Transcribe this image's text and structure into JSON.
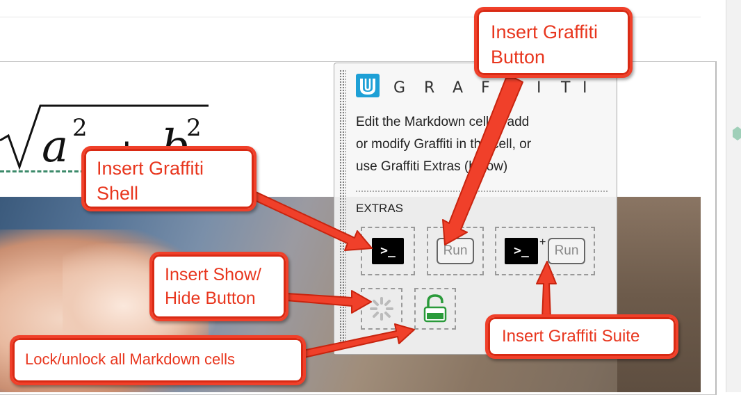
{
  "formula": {
    "latex_visible": "√(a² + b²)",
    "a": "a",
    "b": "b",
    "exp": "2",
    "plus": "+"
  },
  "panel": {
    "title_letters": [
      "G",
      "R",
      "A",
      "F",
      "F",
      "I",
      "T",
      "I"
    ],
    "description": [
      "Edit the Markdown cell to add",
      "or modify Graffiti in the cell, or",
      "use Graffiti Extras (below)"
    ],
    "extras_label": "EXTRAS",
    "buttons": {
      "shell": ">_",
      "run": "Run",
      "suite_shell": ">_",
      "suite_plus": "+",
      "suite_run": "Run"
    }
  },
  "callouts": {
    "insert_button": [
      "Insert Graffiti",
      "Button"
    ],
    "insert_shell": [
      "Insert Graffiti",
      "Shell"
    ],
    "show_hide": [
      "Insert Show/",
      "Hide Button"
    ],
    "suite": "Insert Graffiti Suite",
    "lock": "Lock/unlock all Markdown cells"
  },
  "colors": {
    "callout_red": "#f0402a",
    "logo_blue": "#1ea0d6",
    "lock_green": "#2a9a3a"
  },
  "icons": [
    "udacity-logo-icon",
    "terminal-icon",
    "spinner-icon",
    "lock-icon"
  ]
}
